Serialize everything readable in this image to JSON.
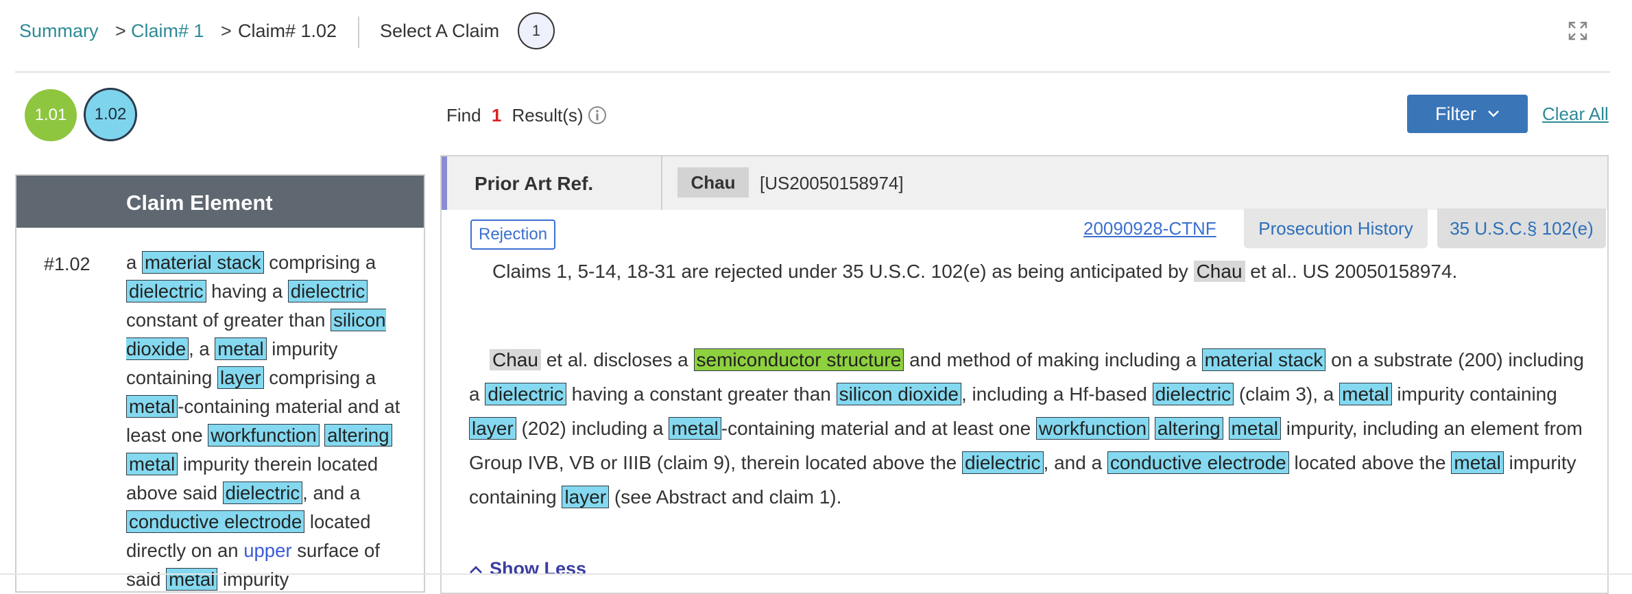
{
  "breadcrumb": {
    "summary": "Summary",
    "claim": "Claim# 1",
    "current": "Claim# 1.02",
    "sep1": ">",
    "sep2": ">"
  },
  "select_claim": {
    "label": "Select A Claim",
    "value": "1"
  },
  "subclaims": [
    "1.01",
    "1.02"
  ],
  "find": {
    "prefix": "Find",
    "count": "1",
    "suffix": "Result(s)"
  },
  "filter_label": "Filter",
  "clear_all": "Clear All",
  "claim_panel": {
    "header": "Claim Element",
    "number": "#1.02",
    "text_parts": [
      "a ",
      "material stack",
      " comprising a ",
      "dielectric",
      " having a ",
      "dielectric",
      " constant of greater than ",
      "silicon dioxide",
      ", a ",
      "metal",
      " impurity containing ",
      "layer",
      " comprising a ",
      "metal",
      "-containing material and at least one ",
      "workfunction",
      " ",
      "altering",
      " ",
      "metal",
      " impurity therein located above said ",
      "dielectric",
      ", and a ",
      "conductive electrode",
      " located directly on an ",
      "upper",
      " surface of said ",
      "metal",
      " impurity"
    ]
  },
  "prior_art": {
    "label": "Prior Art Ref.",
    "author": "Chau",
    "number": "[US20050158974]",
    "rejection_badge": "Rejection",
    "doc_link": "20090928-CTNF",
    "tab_history": "Prosecution History",
    "tab_statute": "35 U.S.C.§ 102(e)",
    "rejection_sentence": [
      "Claims 1, 5-14, 18-31 are rejected under 35 U.S.C. 102(e) as being anticipated by ",
      "Chau",
      " et al.. US 20050158974."
    ],
    "paragraph": [
      "Chau",
      " et al. discloses a ",
      "semiconductor structure",
      " and method of making including a ",
      "material stack",
      " on a substrate (200) including a ",
      "dielectric",
      " having a constant greater than ",
      "silicon dioxide",
      ", including a Hf-based ",
      "dielectric",
      " (claim 3), a ",
      "metal",
      " impurity containing ",
      "layer",
      " (202) including a ",
      "metal",
      "-containing material and at least one ",
      "workfunction",
      " ",
      "altering",
      " ",
      "metal",
      " impurity, including an element from Group IVB, VB or IIIB (claim 9), therein located above the ",
      "dielectric",
      ", and a ",
      "conductive electrode",
      " located above the ",
      "metal",
      " impurity containing ",
      "layer",
      " (see Abstract and claim 1)."
    ],
    "show_less": "Show Less"
  },
  "icons": {
    "expand": "expand-icon",
    "info": "info-icon",
    "chevron": "chevron-down-icon",
    "chevron_up": "chevron-up-icon"
  },
  "colors": {
    "teal_link": "#2d8a96",
    "filter_button": "#3a75b8",
    "highlight_blue": "#84d9f0",
    "highlight_green": "#8ed13e",
    "circle_green": "#8ec63f",
    "count_red": "#e02020",
    "header_gray": "#5f6870"
  }
}
